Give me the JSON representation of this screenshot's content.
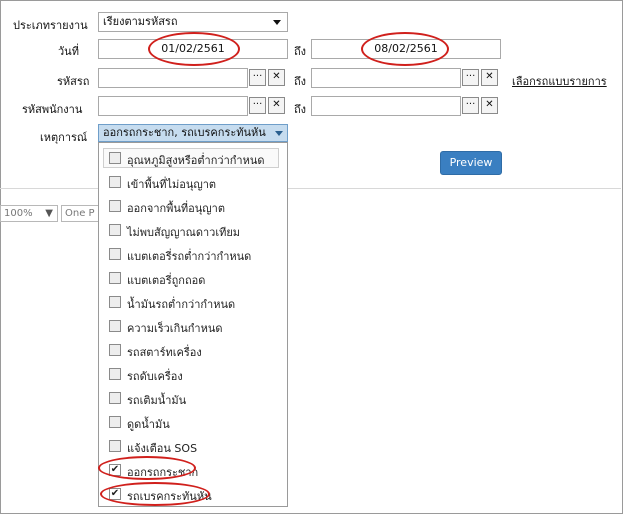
{
  "form": {
    "report_type": {
      "label": "ประเภทรายงาน",
      "value": "เรียงตามรหัสรถ"
    },
    "date": {
      "label": "วันที่",
      "from": "01/02/2561",
      "to_label": "ถึง",
      "to": "08/02/2561"
    },
    "vehicle": {
      "label": "รหัสรถ",
      "from": "",
      "to_label": "ถึง",
      "to": "",
      "link": "เลือกรถแบบรายการ"
    },
    "employee": {
      "label": "รหัสพนักงาน",
      "from": "",
      "to_label": "ถึง",
      "to": ""
    },
    "event": {
      "label": "เหตุการณ์",
      "value": "ออกรถกระชาก, รถเบรคกระทันหัน"
    },
    "browse_glyph": "···",
    "clear_glyph": "✕",
    "preview_label": "Preview"
  },
  "toolbar": {
    "zoom": "100%",
    "page_mode": "One P"
  },
  "event_options": [
    {
      "label": "อุณหภูมิสูงหรือต่ำกว่ากำหนด",
      "checked": false
    },
    {
      "label": "เข้าพื้นที่ไม่อนุญาต",
      "checked": false
    },
    {
      "label": "ออกจากพื้นที่อนุญาต",
      "checked": false
    },
    {
      "label": "ไม่พบสัญญาณดาวเทียม",
      "checked": false
    },
    {
      "label": "แบตเตอรี่รถต่ำกว่ากำหนด",
      "checked": false
    },
    {
      "label": "แบตเตอรี่ถูกถอด",
      "checked": false
    },
    {
      "label": "น้ำมันรถต่ำกว่ากำหนด",
      "checked": false
    },
    {
      "label": "ความเร็วเกินกำหนด",
      "checked": false
    },
    {
      "label": "รถสตาร์ทเครื่อง",
      "checked": false
    },
    {
      "label": "รถดับเครื่อง",
      "checked": false
    },
    {
      "label": "รถเติมน้ำมัน",
      "checked": false
    },
    {
      "label": "ดูดน้ำมัน",
      "checked": false
    },
    {
      "label": "แจ้งเตือน SOS",
      "checked": false
    },
    {
      "label": "ออกรถกระชาก",
      "checked": true
    },
    {
      "label": "รถเบรคกระทันหัน",
      "checked": true
    }
  ],
  "colors": {
    "highlight": "#d0201c",
    "preview": "#3a7fc1",
    "dropdown_head": "#c6dcef"
  }
}
